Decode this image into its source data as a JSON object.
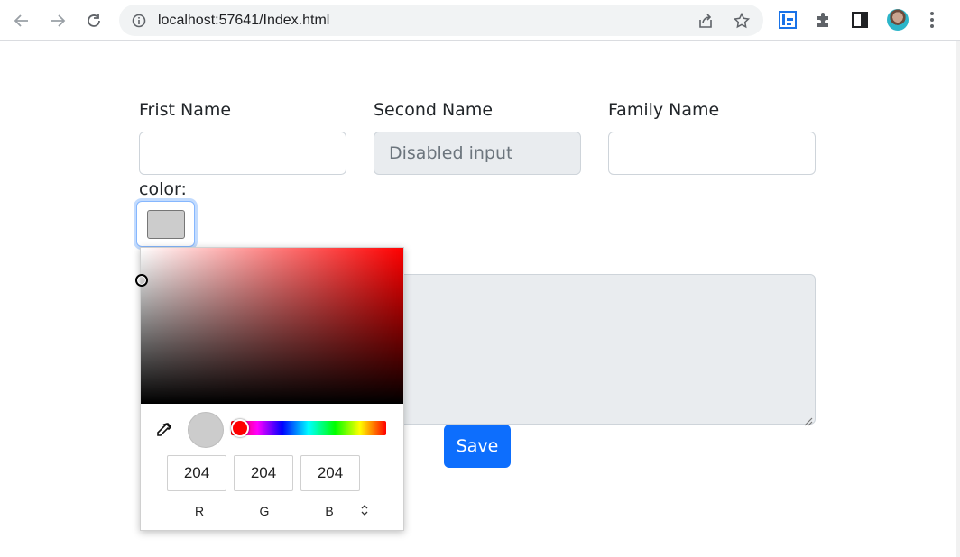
{
  "browser": {
    "url": "localhost:57641/Index.html",
    "icons": [
      "back-icon",
      "forward-icon",
      "reload-icon",
      "site-info-icon",
      "share-icon",
      "bookmark-star-icon",
      "extension-app-icon",
      "puzzle-icon",
      "side-panel-icon",
      "avatar",
      "menu-dots-icon"
    ]
  },
  "form": {
    "first_name": {
      "label": "Frist Name",
      "value": ""
    },
    "second_name": {
      "label": "Second Name",
      "placeholder": "Disabled input"
    },
    "family_name": {
      "label": "Family Name",
      "value": ""
    },
    "color": {
      "label": "color:",
      "value": "#cccccc"
    },
    "save_label": "Save"
  },
  "picker": {
    "r": "204",
    "g": "204",
    "b": "204",
    "labels": {
      "r": "R",
      "g": "G",
      "b": "B"
    },
    "hue_color": "#ff0000"
  }
}
